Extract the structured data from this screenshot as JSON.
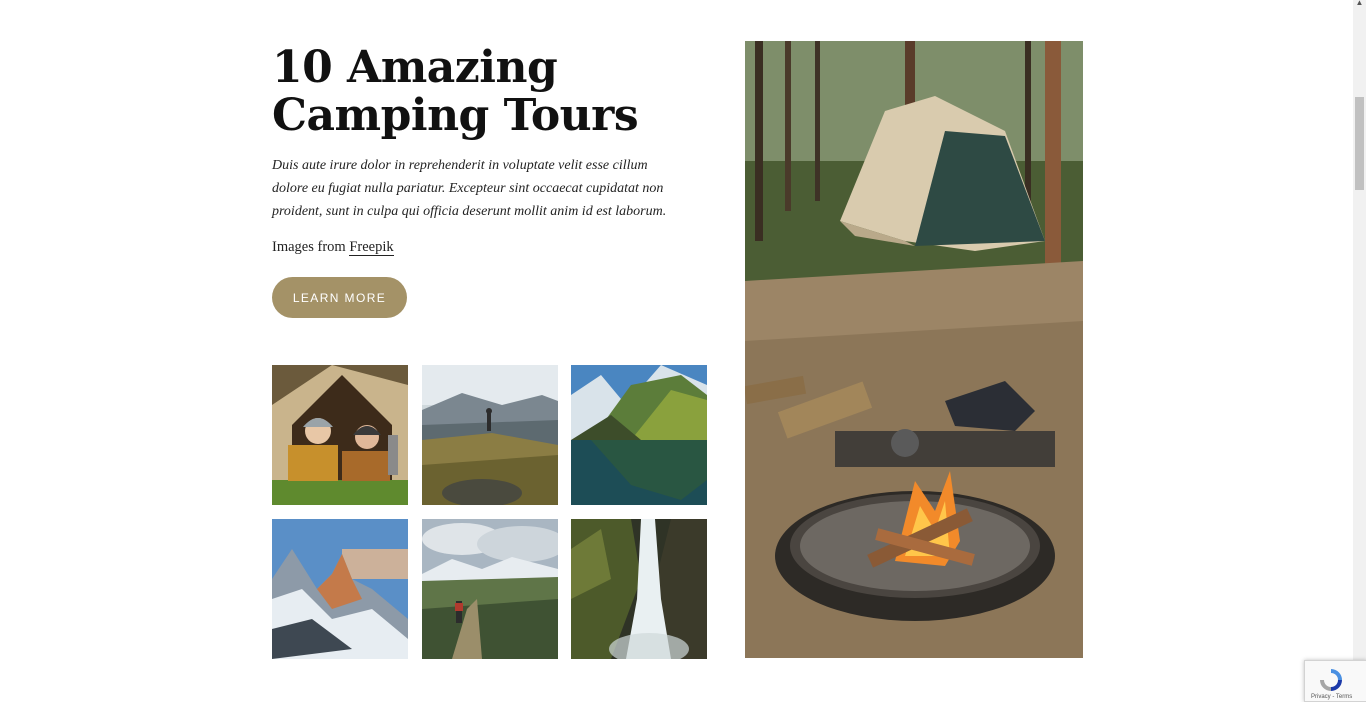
{
  "heading": {
    "line1": "10 Amazing",
    "line2": "Camping Tours"
  },
  "description": "Duis aute irure dolor in reprehenderit in voluptate velit esse cillum dolore eu fugiat nulla pariatur. Excepteur sint occaecat cupidatat non proident, sunt in culpa qui officia deserunt mollit anim id est laborum.",
  "credit": {
    "prefix": "Images from ",
    "link_label": "Freepik"
  },
  "cta": {
    "label": "LEARN MORE"
  },
  "gallery": {
    "thumbnails": [
      "tent-friends-image",
      "hiker-hilltop-image",
      "mountain-lake-image",
      "snowy-peaks-image",
      "valley-hiker-image",
      "waterfall-image"
    ]
  },
  "hero_image": "tent-campfire-image",
  "recaptcha": {
    "label": "Privacy - Terms"
  },
  "colors": {
    "accent": "#a49267",
    "text": "#111111",
    "background": "#ffffff"
  }
}
